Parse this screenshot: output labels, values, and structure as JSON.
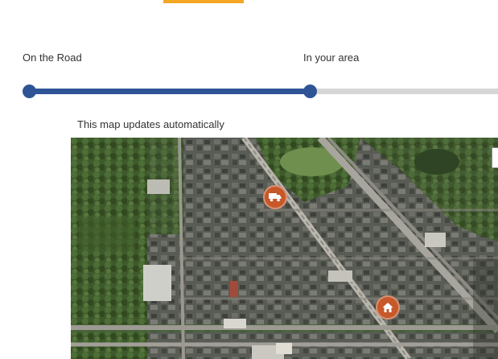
{
  "progress": {
    "stages": [
      {
        "label": "On the Road"
      },
      {
        "label": "In your area"
      }
    ],
    "completed_fraction": 0.58,
    "colors": {
      "fill": "#2f5496",
      "track": "#d6d6d6",
      "accent": "#f5a623"
    }
  },
  "map": {
    "caption": "This map updates automatically",
    "style": "satellite",
    "markers": [
      {
        "icon": "delivery-truck-icon",
        "color": "#c6582a"
      },
      {
        "icon": "home-icon",
        "color": "#c6582a"
      }
    ]
  }
}
